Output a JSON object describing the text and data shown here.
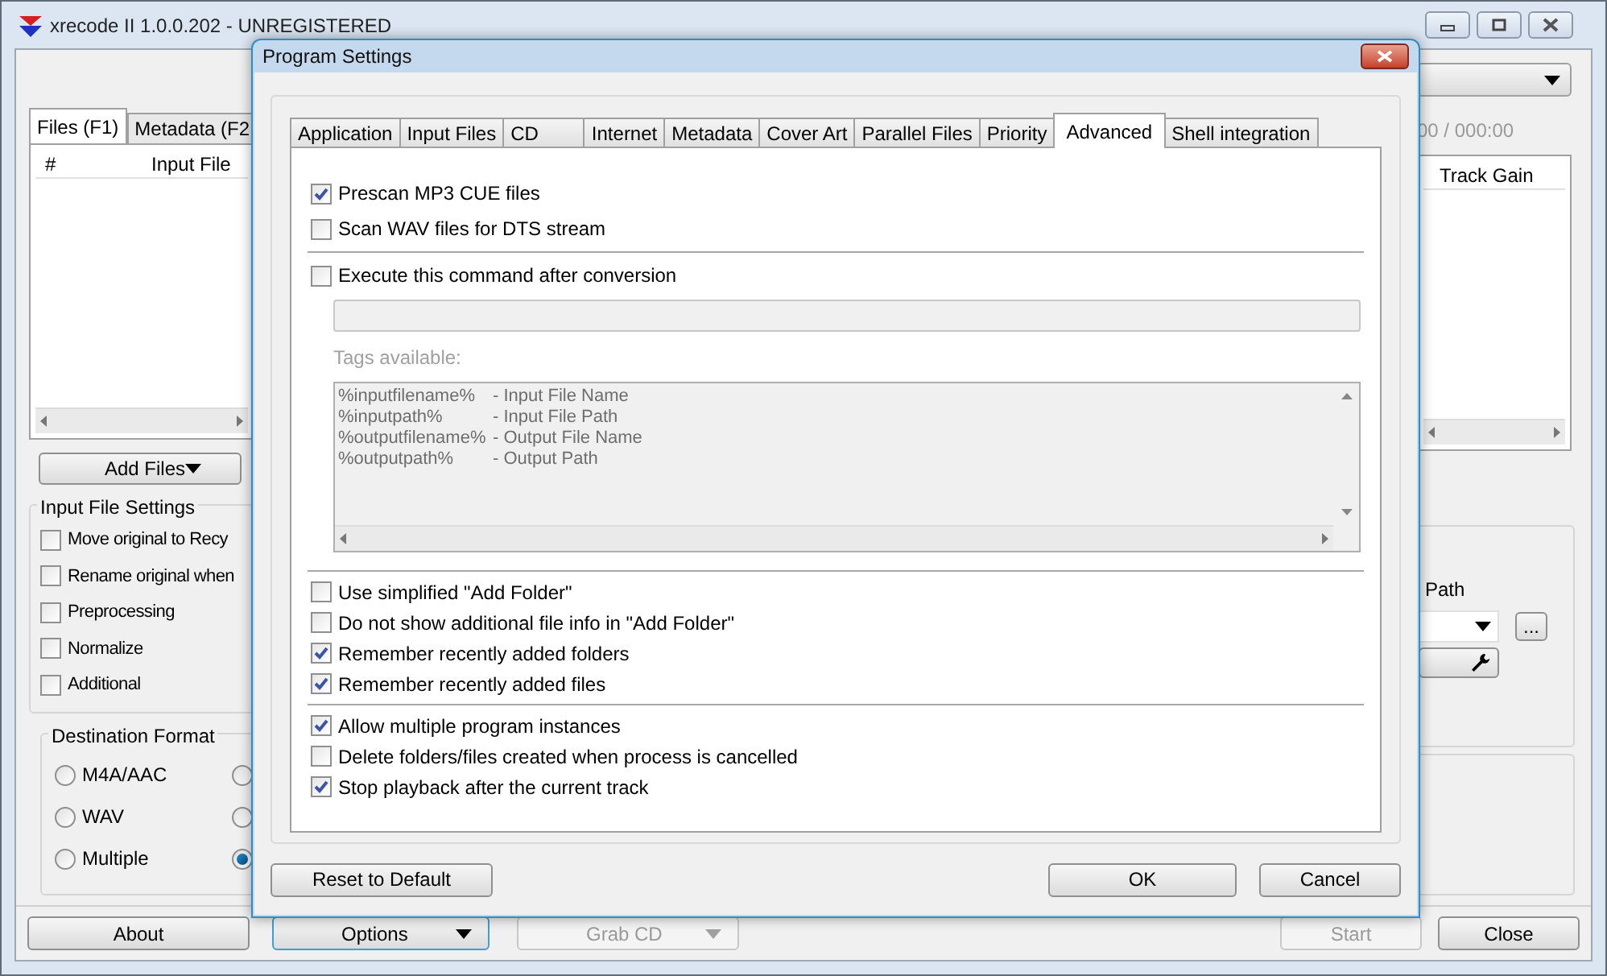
{
  "main_window": {
    "title": "xrecode II 1.0.0.202 - UNREGISTERED",
    "tabs": [
      {
        "label": "Files (F1)",
        "selected": true
      },
      {
        "label": "Metadata (F2",
        "selected": false
      }
    ],
    "file_table": {
      "columns": [
        "#",
        "Input File"
      ],
      "right_columns": [
        "Track Gain"
      ]
    },
    "time_display": "00 / 000:00",
    "add_files_button": "Add Files",
    "input_file_settings": {
      "title": "Input File Settings",
      "options": [
        {
          "label": "Move original to Recy",
          "checked": false
        },
        {
          "label": "Rename original when",
          "checked": false
        },
        {
          "label": "Preprocessing",
          "checked": false
        },
        {
          "label": "Normalize",
          "checked": false
        },
        {
          "label": "Additional",
          "checked": false
        }
      ]
    },
    "destination_format": {
      "title": "Destination Format",
      "options": [
        {
          "label": "M4A/AAC",
          "selected": false
        },
        {
          "label": "WAV",
          "selected": false
        },
        {
          "label": "Multiple",
          "selected": false
        }
      ],
      "column_2_options": [
        {
          "selected": false
        },
        {
          "selected": false
        },
        {
          "selected": true
        }
      ]
    },
    "path_label": "Path",
    "browse_button": "...",
    "buttons": [
      {
        "label": "About",
        "kind": "plain",
        "disabled": false
      },
      {
        "label": "Options",
        "kind": "dropdown",
        "disabled": false
      },
      {
        "label": "Grab CD",
        "kind": "dropdown",
        "disabled": true
      },
      {
        "label": "Start",
        "kind": "plain",
        "disabled": true
      },
      {
        "label": "Close",
        "kind": "plain",
        "disabled": false
      }
    ]
  },
  "dialog": {
    "title": "Program Settings",
    "tabs": [
      {
        "label": "Application",
        "selected": false
      },
      {
        "label": "Input Files",
        "selected": false
      },
      {
        "label": "CD",
        "selected": false
      },
      {
        "label": "Internet",
        "selected": false
      },
      {
        "label": "Metadata",
        "selected": false
      },
      {
        "label": "Cover Art",
        "selected": false
      },
      {
        "label": "Parallel Files",
        "selected": false
      },
      {
        "label": "Priority",
        "selected": false
      },
      {
        "label": "Advanced",
        "selected": true
      },
      {
        "label": "Shell integration",
        "selected": false
      }
    ],
    "scan_options": [
      {
        "label": "Prescan MP3 CUE files",
        "checked": true
      },
      {
        "label": "Scan WAV files for DTS stream",
        "checked": false
      }
    ],
    "execute_command": {
      "label": "Execute this command after conversion",
      "checked": false
    },
    "tags_label": "Tags available:",
    "tags": [
      {
        "tag": "%inputfilename%",
        "description": "- Input File Name"
      },
      {
        "tag": "%inputpath%",
        "description": "- Input File Path"
      },
      {
        "tag": "%outputfilename%",
        "description": "- Output File Name"
      },
      {
        "tag": "%outputpath%",
        "description": "- Output Path"
      }
    ],
    "folder_options": [
      {
        "label": "Use simplified \"Add Folder\"",
        "checked": false
      },
      {
        "label": "Do not show additional file info in \"Add Folder\"",
        "checked": false
      },
      {
        "label": "Remember recently added folders",
        "checked": true
      },
      {
        "label": "Remember recently added files",
        "checked": true
      }
    ],
    "process_options": [
      {
        "label": "Allow multiple program instances",
        "checked": true
      },
      {
        "label": "Delete folders/files created when process is cancelled",
        "checked": false
      },
      {
        "label": "Stop playback after the current track",
        "checked": true
      }
    ],
    "buttons": {
      "reset": "Reset to Default",
      "ok": "OK",
      "cancel": "Cancel"
    }
  }
}
